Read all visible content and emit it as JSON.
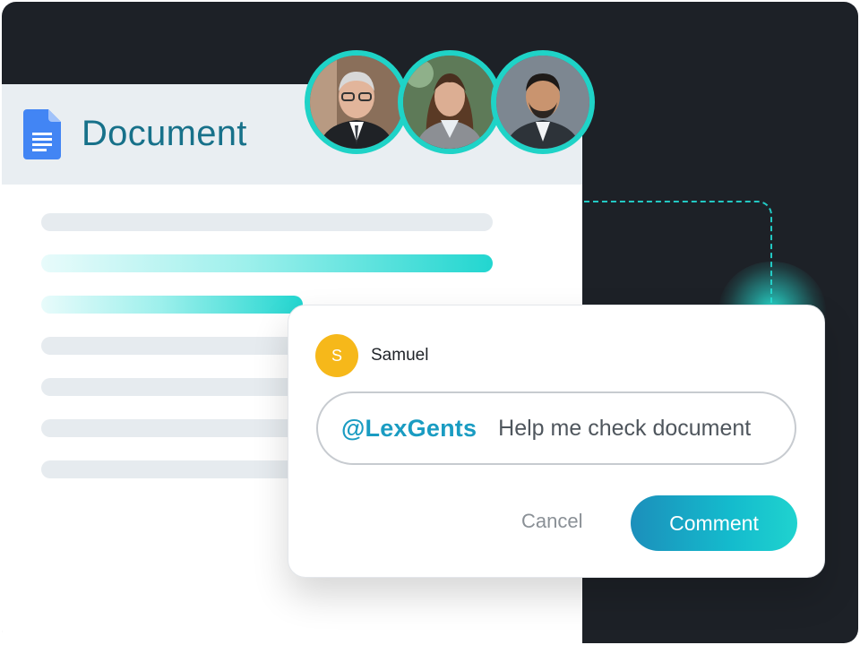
{
  "document": {
    "title": "Document",
    "icon": "google-docs-icon",
    "icon_color": "#4285f4",
    "line_count": 7
  },
  "collaborators": [
    {
      "icon": "person-older-man-glasses-avatar"
    },
    {
      "icon": "person-woman-avatar"
    },
    {
      "icon": "person-man-beard-avatar"
    }
  ],
  "comment": {
    "user": {
      "initial": "S",
      "name": "Samuel",
      "avatar_color": "#f6b81a"
    },
    "input": {
      "mention": "@LexGents",
      "text": "Help me check document"
    },
    "cancel_label": "Cancel",
    "comment_label": "Comment"
  },
  "colors": {
    "accent": "#1fd3c7",
    "dark_bg": "#1d2127",
    "title": "#17718a",
    "mention": "#1a9cc2"
  }
}
